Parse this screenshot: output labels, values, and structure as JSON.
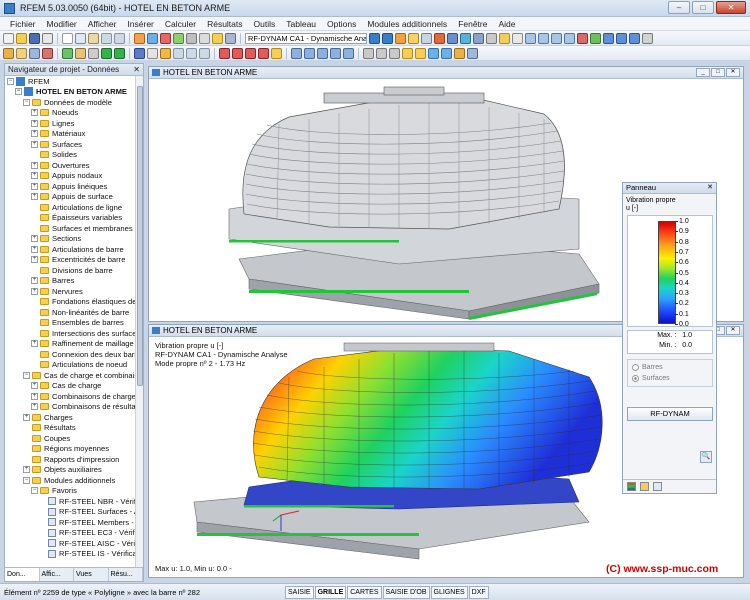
{
  "window": {
    "title": "RFEM 5.03.0050 (64bit) - HOTEL EN BETON ARME",
    "btn_minimize": "–",
    "btn_maximize": "□",
    "btn_close": "✕"
  },
  "menu": [
    "Fichier",
    "Modifier",
    "Afficher",
    "Insérer",
    "Calculer",
    "Résultats",
    "Outils",
    "Tableau",
    "Options",
    "Modules additionnels",
    "Fenêtre",
    "Aide"
  ],
  "toolbar": {
    "loadcase_combo": "RF-DYNAM CA1 - Dynamische Analyse",
    "combo_arrow": "▼"
  },
  "navigator": {
    "title": "Navigateur de projet - Données",
    "close": "✕",
    "items": [
      {
        "label": "RFEM",
        "exp": "−",
        "kind": "root",
        "bold": false
      },
      {
        "label": "HOTEL EN BETON ARME",
        "exp": "−",
        "kind": "root",
        "bold": true
      },
      {
        "label": "Données de modèle",
        "exp": "−",
        "kind": "folder",
        "bold": false
      },
      {
        "label": "Noeuds",
        "exp": "+",
        "kind": "folder",
        "bold": false
      },
      {
        "label": "Lignes",
        "exp": "+",
        "kind": "folder",
        "bold": false
      },
      {
        "label": "Matériaux",
        "exp": "+",
        "kind": "folder",
        "bold": false
      },
      {
        "label": "Surfaces",
        "exp": "+",
        "kind": "folder",
        "bold": false
      },
      {
        "label": "Solides",
        "exp": "",
        "kind": "folder",
        "bold": false
      },
      {
        "label": "Ouvertures",
        "exp": "+",
        "kind": "folder",
        "bold": false
      },
      {
        "label": "Appuis nodaux",
        "exp": "+",
        "kind": "folder",
        "bold": false
      },
      {
        "label": "Appuis linéiques",
        "exp": "+",
        "kind": "folder",
        "bold": false
      },
      {
        "label": "Appuis de surface",
        "exp": "+",
        "kind": "folder",
        "bold": false
      },
      {
        "label": "Articulations de ligne",
        "exp": "",
        "kind": "folder",
        "bold": false
      },
      {
        "label": "Épaisseurs variables",
        "exp": "",
        "kind": "folder",
        "bold": false
      },
      {
        "label": "Surfaces et membranes d",
        "exp": "",
        "kind": "folder",
        "bold": false
      },
      {
        "label": "Sections",
        "exp": "+",
        "kind": "folder",
        "bold": false
      },
      {
        "label": "Articulations de barre",
        "exp": "+",
        "kind": "folder",
        "bold": false
      },
      {
        "label": "Excentricités de barre",
        "exp": "+",
        "kind": "folder",
        "bold": false
      },
      {
        "label": "Divisions de barre",
        "exp": "",
        "kind": "folder",
        "bold": false
      },
      {
        "label": "Barres",
        "exp": "+",
        "kind": "folder",
        "bold": false
      },
      {
        "label": "Nervures",
        "exp": "+",
        "kind": "folder",
        "bold": false
      },
      {
        "label": "Fondations élastiques de",
        "exp": "",
        "kind": "folder",
        "bold": false
      },
      {
        "label": "Non-linéarités de barre",
        "exp": "",
        "kind": "folder",
        "bold": false
      },
      {
        "label": "Ensembles de barres",
        "exp": "",
        "kind": "folder",
        "bold": false
      },
      {
        "label": "Intersections des surfaces",
        "exp": "",
        "kind": "folder",
        "bold": false
      },
      {
        "label": "Raffinement de maillage",
        "exp": "+",
        "kind": "folder",
        "bold": false
      },
      {
        "label": "Connexion des deux barr",
        "exp": "",
        "kind": "folder",
        "bold": false
      },
      {
        "label": "Articulations de noeud",
        "exp": "",
        "kind": "folder",
        "bold": false
      },
      {
        "label": "Cas de charge et combinaiso",
        "exp": "−",
        "kind": "folder",
        "bold": false
      },
      {
        "label": "Cas de charge",
        "exp": "+",
        "kind": "folder",
        "bold": false
      },
      {
        "label": "Combinaisons de charge",
        "exp": "+",
        "kind": "folder",
        "bold": false
      },
      {
        "label": "Combinaisons de résultat",
        "exp": "+",
        "kind": "folder",
        "bold": false
      },
      {
        "label": "Charges",
        "exp": "+",
        "kind": "folder",
        "bold": false
      },
      {
        "label": "Résultats",
        "exp": "",
        "kind": "folder",
        "bold": false
      },
      {
        "label": "Coupes",
        "exp": "",
        "kind": "folder",
        "bold": false
      },
      {
        "label": "Régions moyennes",
        "exp": "",
        "kind": "folder",
        "bold": false
      },
      {
        "label": "Rapports d'impression",
        "exp": "",
        "kind": "folder",
        "bold": false
      },
      {
        "label": "Objets auxiliaires",
        "exp": "+",
        "kind": "folder",
        "bold": false
      },
      {
        "label": "Modules additionnels",
        "exp": "−",
        "kind": "folder",
        "bold": false
      },
      {
        "label": "Favoris",
        "exp": "−",
        "kind": "folder",
        "bold": false
      },
      {
        "label": "RF-STEEL NBR - Vérifi",
        "exp": "",
        "kind": "doc",
        "bold": false
      },
      {
        "label": "RF-STEEL Surfaces - Anal",
        "exp": "",
        "kind": "doc",
        "bold": false
      },
      {
        "label": "RF-STEEL Members - Anal",
        "exp": "",
        "kind": "doc",
        "bold": false
      },
      {
        "label": "RF-STEEL EC3 - Vérificati",
        "exp": "",
        "kind": "doc",
        "bold": false
      },
      {
        "label": "RF-STEEL AISC - Vérificat",
        "exp": "",
        "kind": "doc",
        "bold": false
      },
      {
        "label": "RF-STEEL IS - Vérification",
        "exp": "",
        "kind": "doc",
        "bold": false
      }
    ],
    "tabs": [
      "Don...",
      "Affic...",
      "Vues",
      "Résu..."
    ]
  },
  "views": {
    "top": {
      "title": "HOTEL EN BETON ARME",
      "btns": [
        "_",
        "□",
        "✕"
      ]
    },
    "bottom": {
      "title": "HOTEL EN BETON ARME",
      "btns": [
        "_",
        "□",
        "✕"
      ],
      "info_line1": "Vibration propre  u [-]",
      "info_line2": "RF-DYNAM CA1 - Dynamische Analyse",
      "info_line3": "Mode propre nº 2 - 1.73 Hz",
      "footer": "Max u: 1.0, Min u: 0.0 -"
    }
  },
  "panel": {
    "title": "Panneau",
    "close": "✕",
    "result_name": "Vibration propre",
    "result_unit": "u [-]",
    "legend_values": [
      "1.0",
      "0.9",
      "0.8",
      "0.7",
      "0.6",
      "0.5",
      "0.4",
      "0.3",
      "0.2",
      "0.1",
      "0.0"
    ],
    "max_label": "Max. :",
    "max_value": "1.0",
    "min_label": "Min. :",
    "min_value": "0.0",
    "radio_barres": "Barres",
    "radio_surfaces": "Surfaces",
    "button": "RF-DYNAM",
    "zoom_icon": "🔍"
  },
  "copyright": "(C) www.ssp-muc.com",
  "status": {
    "text": "Élément nº 2259 de type « Polyligne » avec la barre nº 282",
    "tabs": [
      "SAISIE",
      "GRILLE",
      "CARTES",
      "SAISIE D'OB",
      "GLIGNES",
      "DXF"
    ]
  },
  "colors": {
    "accent": "#3a7dc9",
    "copyright": "#d20000",
    "support_green": "#22c43a"
  }
}
